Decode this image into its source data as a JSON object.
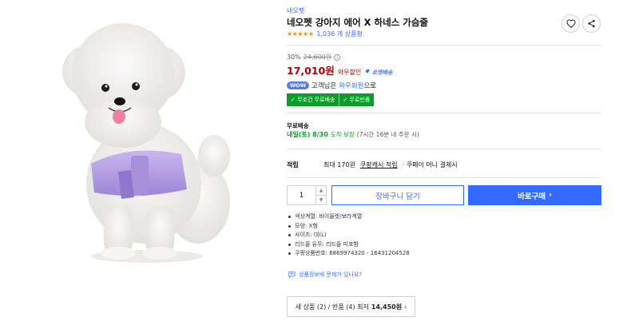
{
  "brand": "네오펫",
  "title": "네오펫 강아지 에어 X 하네스 가슴줄",
  "rating": {
    "stars": 4.5,
    "review_count": "1,036 개 상품평"
  },
  "price": {
    "discount_rate": "30%",
    "original": "24,600원",
    "sale": "17,010원",
    "sale_label": "와우할인",
    "delivery_badge": "로켓배송"
  },
  "wow": {
    "badge": "WOW",
    "prefix": "고객님은",
    "link": "와우회원",
    "suffix": "으로"
  },
  "benefits": [
    "무조건 무료배송",
    "무료반품"
  ],
  "shipping": {
    "title": "무료배송",
    "date": "내일(토) 8/30",
    "guarantee": "도착 보장",
    "note": "(7시간 16분 내 주문 시)"
  },
  "cash": {
    "label": "적립",
    "prefix": "최대 170원",
    "link": "쿠팡캐시 적립",
    "suffix": "· 쿠페이 머니 결제시"
  },
  "quantity": "1",
  "buttons": {
    "cart": "장바구니 담기",
    "buy": "바로구매"
  },
  "attributes": [
    "색상계열: 바이올렛/보라계열",
    "모양: X형",
    "사이즈: 대(L)",
    "리드줄 유무: 리드줄 미포함",
    "쿠팡상품번호: 6869974320 - 16431204528"
  ],
  "report_link": "상품정보에 문제가 있나요?",
  "other_sellers": {
    "text": "새 상품 (2) / 반품 (4) 최저",
    "price": "14,450원"
  },
  "colors": {
    "accent": "#346aff",
    "sale": "#ae0000",
    "green": "#0b9c2a",
    "star": "#ff8a00"
  }
}
